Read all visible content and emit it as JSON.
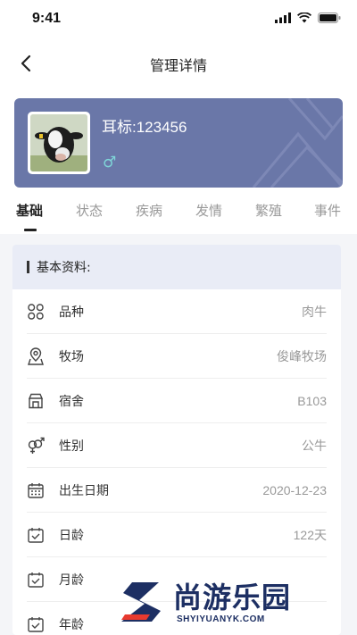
{
  "status_bar": {
    "time": "9:41"
  },
  "nav": {
    "title": "管理详情"
  },
  "profile": {
    "ear_tag": "耳标:123456",
    "gender_symbol": "♂"
  },
  "tabs": [
    {
      "label": "基础"
    },
    {
      "label": "状态"
    },
    {
      "label": "疾病"
    },
    {
      "label": "发情"
    },
    {
      "label": "繁殖"
    },
    {
      "label": "事件"
    }
  ],
  "panel": {
    "title": "基本资料:",
    "rows": [
      {
        "icon": "category-icon",
        "label": "品种",
        "value": "肉牛"
      },
      {
        "icon": "location-icon",
        "label": "牧场",
        "value": "俊峰牧场"
      },
      {
        "icon": "house-icon",
        "label": "宿舍",
        "value": "B103"
      },
      {
        "icon": "gender-icon",
        "label": "性别",
        "value": "公牛"
      },
      {
        "icon": "calendar-icon",
        "label": "出生日期",
        "value": "2020-12-23"
      },
      {
        "icon": "calendar-check-icon",
        "label": "日龄",
        "value": "122天"
      },
      {
        "icon": "calendar-check-icon",
        "label": "月龄",
        "value": ""
      },
      {
        "icon": "calendar-check-icon",
        "label": "年龄",
        "value": ""
      }
    ]
  },
  "watermark": {
    "title": "尚游乐园",
    "url": "SHYIYUANYK.COM"
  },
  "colors": {
    "card": "#6a77a8",
    "panel_header": "#e9ecf6",
    "background": "#f4f5f8"
  }
}
